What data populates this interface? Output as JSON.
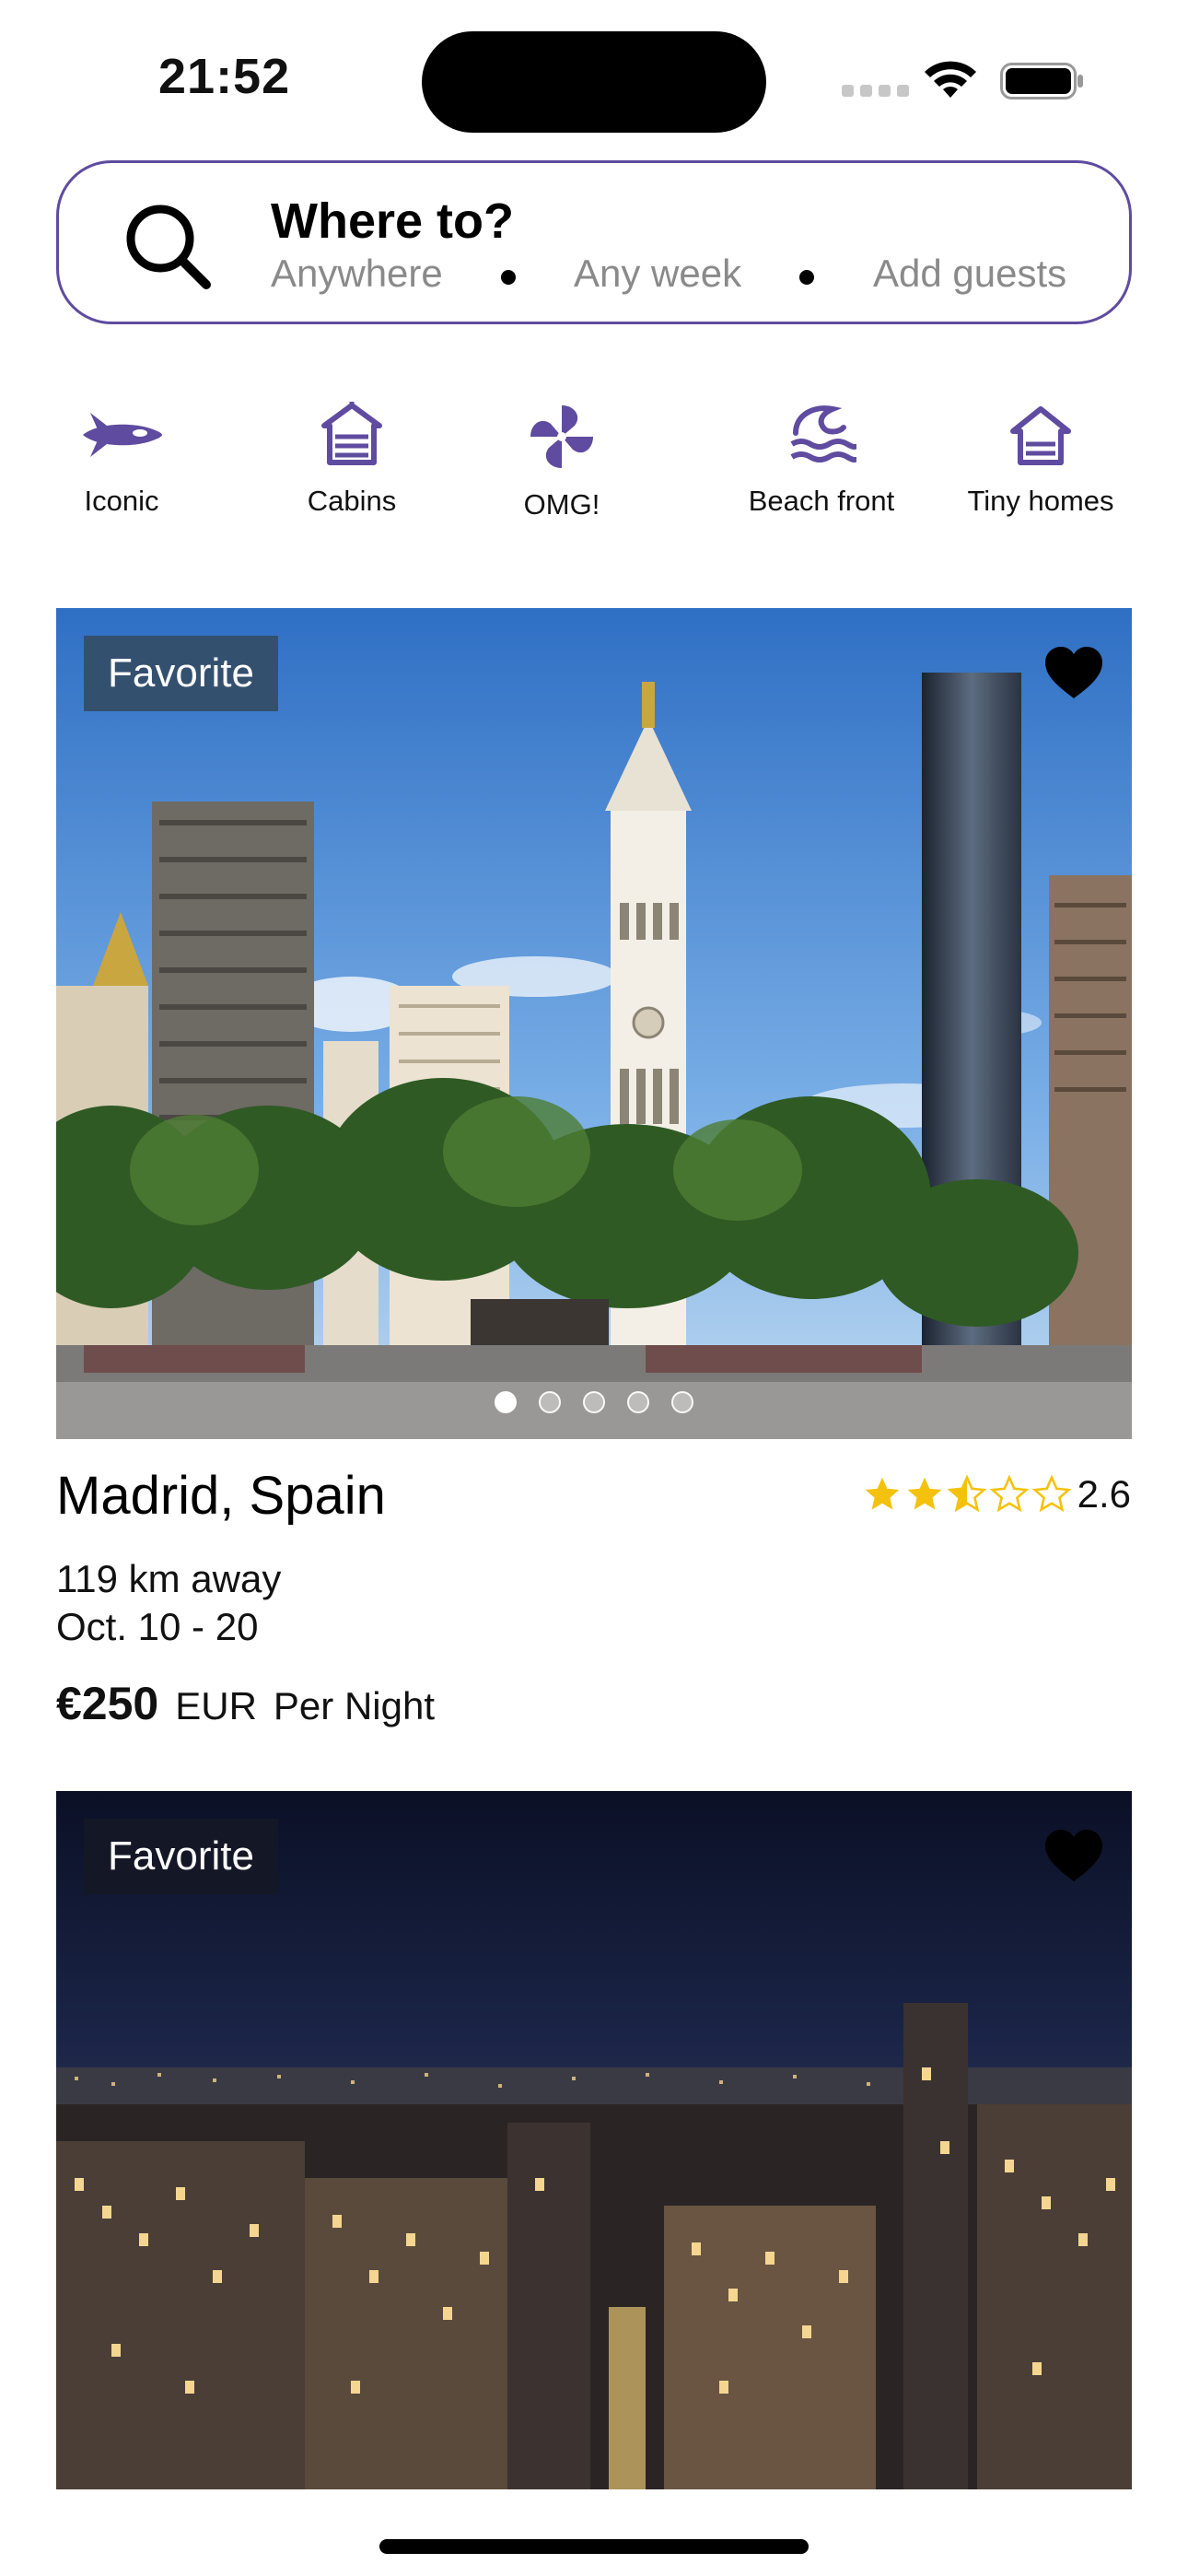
{
  "status_bar": {
    "time": "21:52"
  },
  "search": {
    "title": "Where to?",
    "where": "Anywhere",
    "when": "Any week",
    "guests": "Add guests"
  },
  "categories": [
    {
      "label": "Iconic",
      "icon": "spaceship-icon"
    },
    {
      "label": "Cabins",
      "icon": "cabin-icon"
    },
    {
      "label": "OMG!",
      "icon": "pinwheel-icon"
    },
    {
      "label": "Beach front",
      "icon": "beach-wave-icon"
    },
    {
      "label": "Tiny homes",
      "icon": "tiny-home-icon"
    }
  ],
  "listings": [
    {
      "badge": "Favorite",
      "title": "Madrid, Spain",
      "rating": 2.6,
      "rating_text": "2.6",
      "distance": "119 km away",
      "dates": "Oct. 10 - 20",
      "price": "€250",
      "currency": "EUR",
      "per": "Per Night",
      "photo_count": 5,
      "active_photo": 1,
      "favorited": true
    },
    {
      "badge": "Favorite",
      "favorited": true
    }
  ],
  "colors": {
    "accent": "#5f4b9f",
    "star": "#f4c20d",
    "search_border": "#5f4b9f"
  }
}
